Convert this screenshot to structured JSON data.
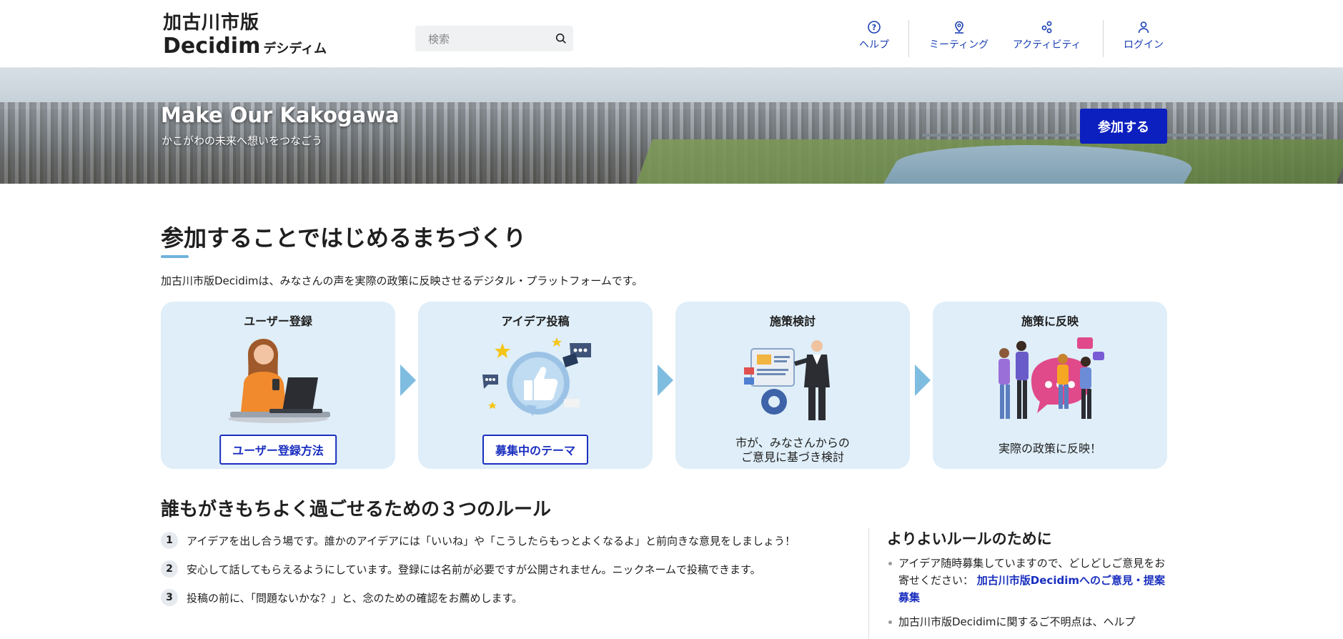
{
  "header": {
    "logo_line1": "加古川市版",
    "logo_line2": "Decidim",
    "logo_line2_sub": "デシディム",
    "search_placeholder": "検索",
    "nav": {
      "help": "ヘルプ",
      "meetings": "ミーティング",
      "activity": "アクティビティ",
      "login": "ログイン"
    }
  },
  "hero": {
    "title": "Make Our Kakogawa",
    "subtitle": "かこがわの未来へ想いをつなごう",
    "join_button": "参加する"
  },
  "main": {
    "title": "参加することではじめるまちづくり",
    "intro": "加古川市版Decidimは、みなさんの声を実際の政策に反映させるデジタル・プラットフォームです。",
    "steps": [
      {
        "title": "ユーザー登録",
        "button": "ユーザー登録方法"
      },
      {
        "title": "アイデア投稿",
        "button": "募集中のテーマ"
      },
      {
        "title": "施策検討",
        "text_line1": "市が、みなさんからの",
        "text_line2": "ご意見に基づき検討"
      },
      {
        "title": "施策に反映",
        "text_line1": "実際の政策に反映！"
      }
    ]
  },
  "rules": {
    "title": "誰もがきもちよく過ごせるための３つのルール",
    "items": [
      {
        "num": "1",
        "text": "アイデアを出し合う場です。誰かのアイデアには「いいね」や「こうしたらもっとよくなるよ」と前向きな意見をしましょう！"
      },
      {
        "num": "2",
        "text": "安心して話してもらえるようにしています。登録には名前が必要ですが公開されません。ニックネームで投稿できます。"
      },
      {
        "num": "3",
        "text": "投稿の前に、「問題ないかな？」と、念のための確認をお薦めします。"
      }
    ]
  },
  "sidebar": {
    "title": "よりよいルールのために",
    "item1_text": "アイデア随時募集していますので、どしどしご意見をお寄せください：",
    "item1_link": "加古川市版Decidimへのご意見・提案募集",
    "item2_text": "加古川市版Decidimに関するご不明点は、ヘルプ"
  },
  "colors": {
    "primary": "#0c1fbf",
    "card_bg": "#dfeef8",
    "arrow": "#7fbde0",
    "nav_link": "#1a3fb4"
  }
}
